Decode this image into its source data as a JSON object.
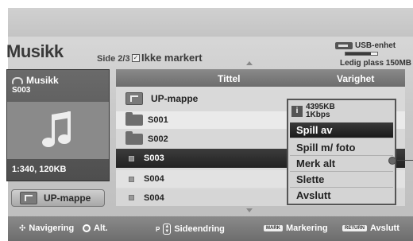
{
  "header": {
    "title": "Musikk",
    "page": "Side 2/3",
    "mark_status": "Ikke markert",
    "device": "USB-enhet",
    "device_usage_fraction": 0.8,
    "free_space": "Ledig plass 150MB"
  },
  "preview": {
    "category": "Musikk",
    "file_name": "S003",
    "info": "1:340, 120KB"
  },
  "up_folder_button": "UP-mappe",
  "list": {
    "columns": [
      "Tittel",
      "Varighet"
    ],
    "up_row": "UP-mappe",
    "rows": [
      {
        "name": "S001",
        "type": "folder"
      },
      {
        "name": "S002",
        "type": "folder"
      },
      {
        "name": "S003",
        "type": "file"
      },
      {
        "name": "S004",
        "type": "file"
      },
      {
        "name": "S004",
        "type": "file"
      }
    ]
  },
  "popup": {
    "info_size": "4395KB",
    "info_rate": "1Kbps",
    "items": [
      "Spill av",
      "Spill m/ foto",
      "Merk alt",
      "Slette",
      "Avslutt"
    ],
    "selected_index": 0
  },
  "footer": {
    "nav": "Navigering",
    "alt": "Alt.",
    "page_key": "P",
    "page_change": "Sideendring",
    "mark_key": "MARK",
    "mark": "Markering",
    "return_key": "RETURN",
    "exit": "Avslutt"
  },
  "colors": {
    "background": "#c9c9c9",
    "header_bar": "#7a7a7a",
    "selected": "#2a2a2a",
    "text": "#222222"
  },
  "icons": [
    "usb-icon",
    "music-note-icon",
    "folder-icon",
    "up-folder-icon",
    "info-icon",
    "navigation-icon",
    "ok-icon"
  ]
}
